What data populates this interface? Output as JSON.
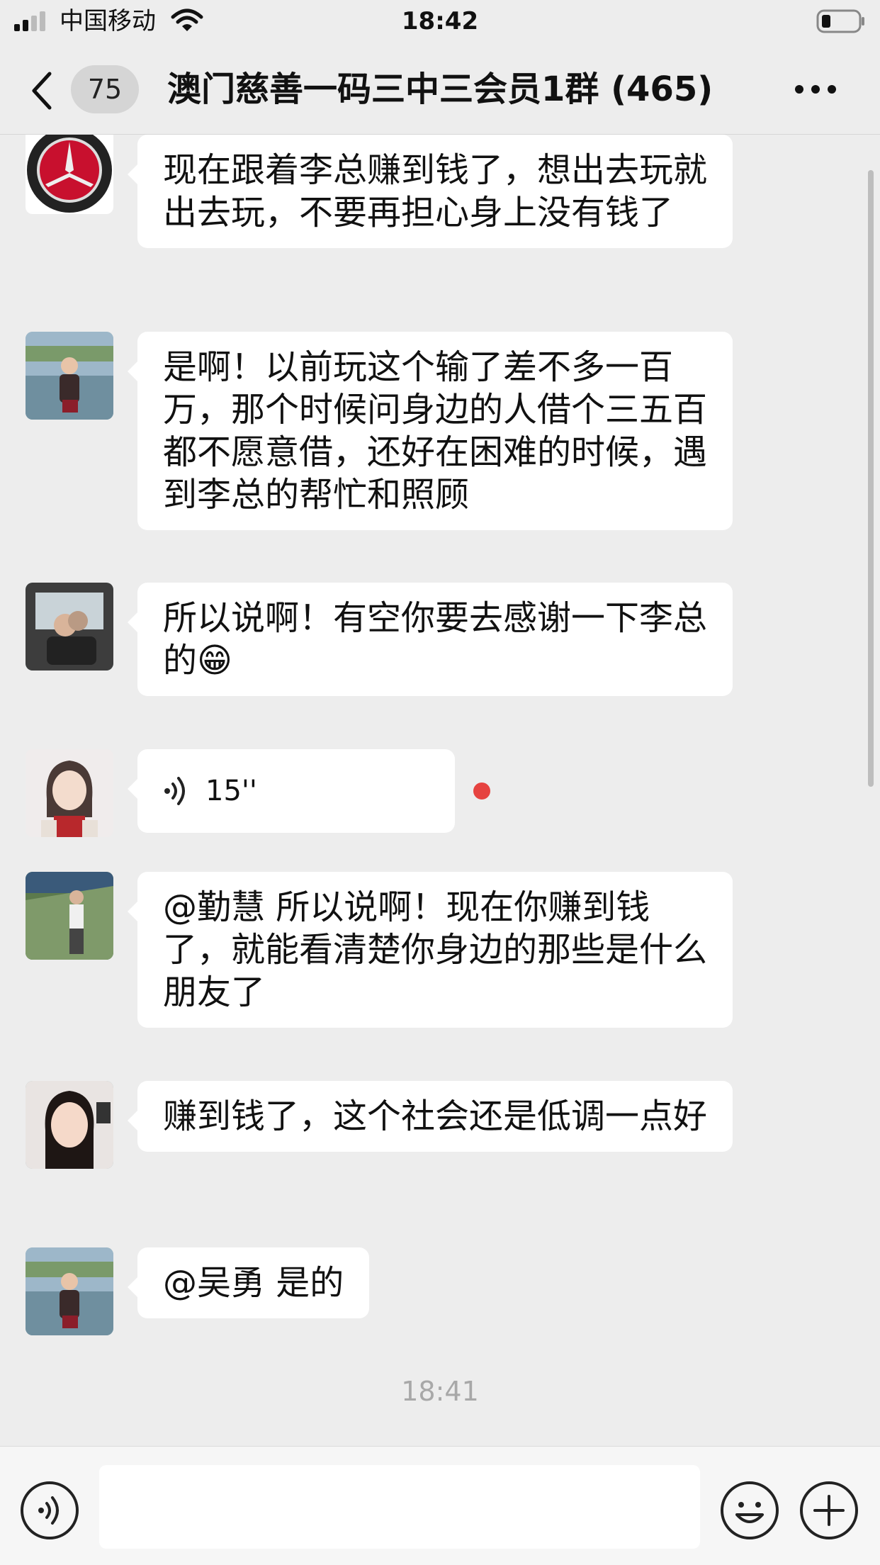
{
  "status_bar": {
    "carrier": "中国移动",
    "time": "18:42"
  },
  "nav": {
    "unread_count": "75",
    "title": "澳门慈善一码三中三会员1群 (465)"
  },
  "messages": [
    {
      "type": "text",
      "avatar": "mercedes-benz-logo-avatar",
      "text": "现在跟着李总赚到钱了，想出去玩就出去玩，不要再担心身上没有钱了"
    },
    {
      "type": "text",
      "avatar": "woman-lakeside-avatar",
      "text": "是啊！以前玩这个输了差不多一百万，那个时候问身边的人借个三五百都不愿意借，还好在困难的时候，遇到李总的帮忙和照顾"
    },
    {
      "type": "text",
      "avatar": "couple-car-avatar",
      "text": "所以说啊！有空你要去感谢一下李总的😁"
    },
    {
      "type": "voice",
      "avatar": "anime-girl-avatar",
      "duration": "15''",
      "unread": true
    },
    {
      "type": "text",
      "avatar": "man-bridge-avatar",
      "text": "@勤慧 所以说啊！现在你赚到钱了，就能看清楚你身边的那些是什么朋友了"
    },
    {
      "type": "text",
      "avatar": "woman-portrait-avatar",
      "text": "赚到钱了，这个社会还是低调一点好"
    },
    {
      "type": "text",
      "avatar": "woman-lakeside-avatar",
      "text": "@吴勇 是的"
    }
  ],
  "timestamp": "18:41",
  "input": {
    "value": ""
  },
  "colors": {
    "background": "#ededed",
    "bubble": "#ffffff",
    "unread_dot": "#e64340",
    "timestamp": "#a8a8a8"
  }
}
